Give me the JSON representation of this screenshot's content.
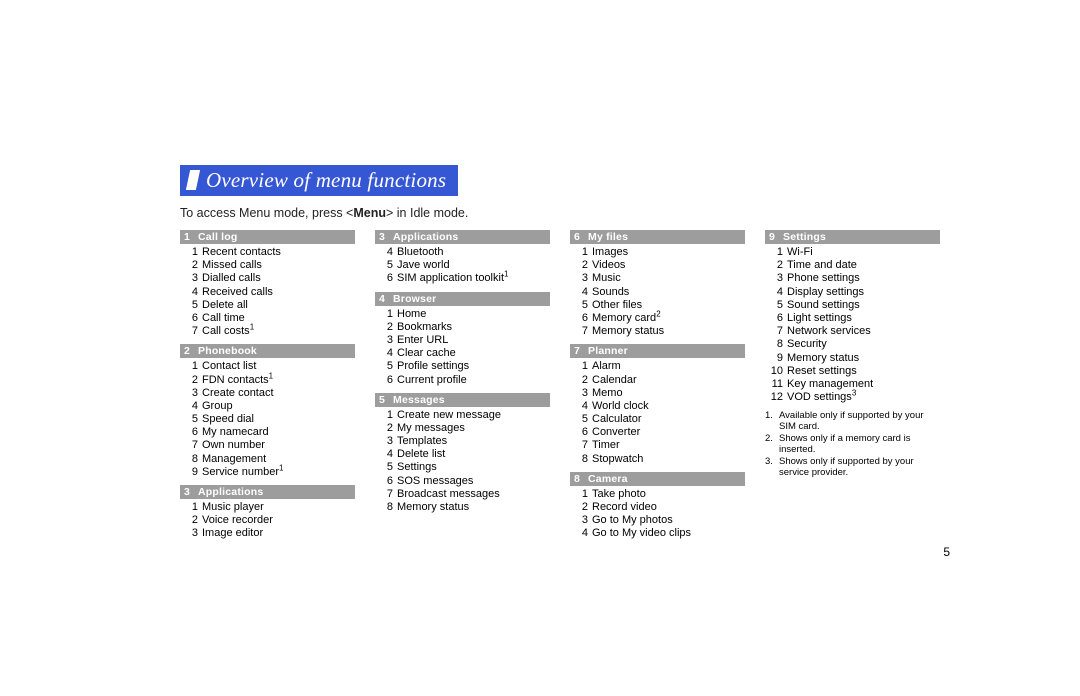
{
  "title": "Overview of menu functions",
  "intro_prefix": "To access Menu mode, press <",
  "intro_bold": "Menu",
  "intro_suffix": "> in Idle mode.",
  "page_number": "5",
  "columns": [
    [
      {
        "num": "1",
        "title": "Call log",
        "items": [
          {
            "n": "1",
            "t": "Recent contacts"
          },
          {
            "n": "2",
            "t": "Missed calls"
          },
          {
            "n": "3",
            "t": "Dialled calls"
          },
          {
            "n": "4",
            "t": "Received calls"
          },
          {
            "n": "5",
            "t": "Delete all"
          },
          {
            "n": "6",
            "t": "Call time"
          },
          {
            "n": "7",
            "t": "Call costs",
            "sup": "1"
          }
        ]
      },
      {
        "num": "2",
        "title": "Phonebook",
        "items": [
          {
            "n": "1",
            "t": "Contact list"
          },
          {
            "n": "2",
            "t": "FDN contacts",
            "sup": "1"
          },
          {
            "n": "3",
            "t": "Create contact"
          },
          {
            "n": "4",
            "t": "Group"
          },
          {
            "n": "5",
            "t": "Speed dial"
          },
          {
            "n": "6",
            "t": "My namecard"
          },
          {
            "n": "7",
            "t": "Own number"
          },
          {
            "n": "8",
            "t": "Management"
          },
          {
            "n": "9",
            "t": "Service number",
            "sup": "1"
          }
        ]
      },
      {
        "num": "3",
        "title": "Applications",
        "items": [
          {
            "n": "1",
            "t": "Music player"
          },
          {
            "n": "2",
            "t": "Voice recorder"
          },
          {
            "n": "3",
            "t": "Image editor"
          }
        ]
      }
    ],
    [
      {
        "num": "3",
        "title": "Applications",
        "items": [
          {
            "n": "4",
            "t": "Bluetooth"
          },
          {
            "n": "5",
            "t": "Jave world"
          },
          {
            "n": "6",
            "t": "SIM application toolkit",
            "sup": "1"
          }
        ]
      },
      {
        "num": "4",
        "title": "Browser",
        "items": [
          {
            "n": "1",
            "t": "Home"
          },
          {
            "n": "2",
            "t": "Bookmarks"
          },
          {
            "n": "3",
            "t": "Enter URL"
          },
          {
            "n": "4",
            "t": "Clear cache"
          },
          {
            "n": "5",
            "t": "Profile settings"
          },
          {
            "n": "6",
            "t": "Current profile"
          }
        ]
      },
      {
        "num": "5",
        "title": "Messages",
        "items": [
          {
            "n": "1",
            "t": "Create new message"
          },
          {
            "n": "2",
            "t": "My messages"
          },
          {
            "n": "3",
            "t": "Templates"
          },
          {
            "n": "4",
            "t": "Delete list"
          },
          {
            "n": "5",
            "t": "Settings"
          },
          {
            "n": "6",
            "t": "SOS messages"
          },
          {
            "n": "7",
            "t": "Broadcast messages"
          },
          {
            "n": "8",
            "t": "Memory status"
          }
        ]
      }
    ],
    [
      {
        "num": "6",
        "title": "My files",
        "items": [
          {
            "n": "1",
            "t": "Images"
          },
          {
            "n": "2",
            "t": "Videos"
          },
          {
            "n": "3",
            "t": "Music"
          },
          {
            "n": "4",
            "t": "Sounds"
          },
          {
            "n": "5",
            "t": "Other files"
          },
          {
            "n": "6",
            "t": "Memory card",
            "sup": "2"
          },
          {
            "n": "7",
            "t": "Memory status"
          }
        ]
      },
      {
        "num": "7",
        "title": "Planner",
        "items": [
          {
            "n": "1",
            "t": "Alarm"
          },
          {
            "n": "2",
            "t": "Calendar"
          },
          {
            "n": "3",
            "t": "Memo"
          },
          {
            "n": "4",
            "t": "World clock"
          },
          {
            "n": "5",
            "t": "Calculator"
          },
          {
            "n": "6",
            "t": "Converter"
          },
          {
            "n": "7",
            "t": "Timer"
          },
          {
            "n": "8",
            "t": "Stopwatch"
          }
        ]
      },
      {
        "num": "8",
        "title": "Camera",
        "items": [
          {
            "n": "1",
            "t": "Take photo"
          },
          {
            "n": "2",
            "t": "Record video"
          },
          {
            "n": "3",
            "t": "Go to My photos"
          },
          {
            "n": "4",
            "t": "Go to My video clips"
          }
        ]
      }
    ],
    [
      {
        "num": "9",
        "title": "Settings",
        "items": [
          {
            "n": "1",
            "t": "Wi-Fi"
          },
          {
            "n": "2",
            "t": "Time and date"
          },
          {
            "n": "3",
            "t": "Phone settings"
          },
          {
            "n": "4",
            "t": "Display settings"
          },
          {
            "n": "5",
            "t": "Sound settings"
          },
          {
            "n": "6",
            "t": "Light settings"
          },
          {
            "n": "7",
            "t": "Network services"
          },
          {
            "n": "8",
            "t": "Security"
          },
          {
            "n": "9",
            "t": "Memory status"
          },
          {
            "n": "10",
            "t": "Reset settings"
          },
          {
            "n": "11",
            "t": "Key management"
          },
          {
            "n": "12",
            "t": "VOD settings",
            "sup": "3"
          }
        ]
      }
    ]
  ],
  "footnotes": [
    {
      "n": "1.",
      "t": "Available only if supported by your SIM card."
    },
    {
      "n": "2.",
      "t": "Shows only if a memory card is inserted."
    },
    {
      "n": "3.",
      "t": "Shows only if supported by your service provider."
    }
  ]
}
